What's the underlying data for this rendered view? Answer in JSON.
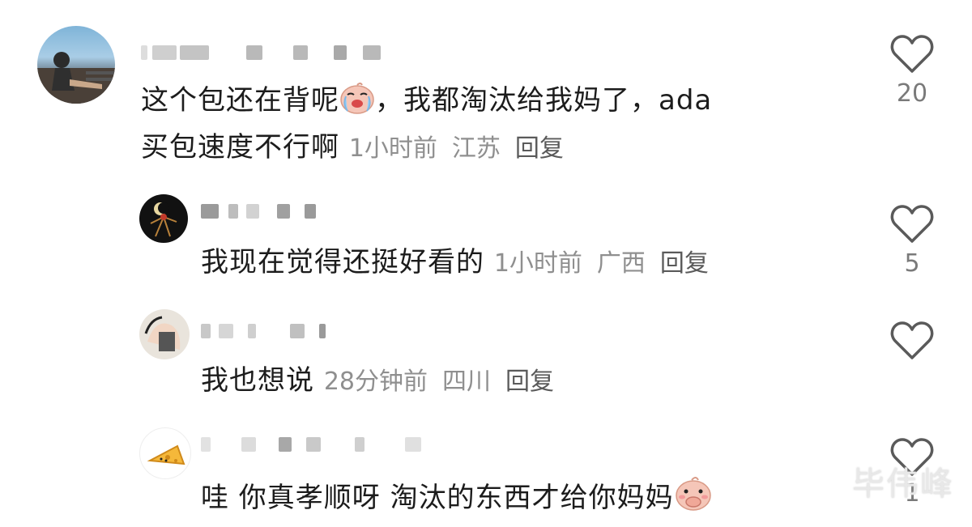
{
  "comments": [
    {
      "line1": "这个包还在背呢",
      "line1b": "，我都淘汰给我妈了，ada",
      "line2": "买包速度不行啊",
      "time": "1小时前",
      "location": "江苏",
      "reply": "回复",
      "likes": "20"
    },
    {
      "text": "我现在觉得还挺好看的",
      "time": "1小时前",
      "location": "广西",
      "reply": "回复",
      "likes": "5"
    },
    {
      "text": "我也想说",
      "time": "28分钟前",
      "location": "四川",
      "reply": "回复",
      "likes": ""
    },
    {
      "text": "哇 你真孝顺呀 淘汰的东西才给你妈妈",
      "likes": "1"
    }
  ],
  "watermark": "毕伟峰",
  "colors": {
    "text": "#1c1c1c",
    "meta": "#8f8f8f",
    "heart": "#5a5a5a"
  }
}
